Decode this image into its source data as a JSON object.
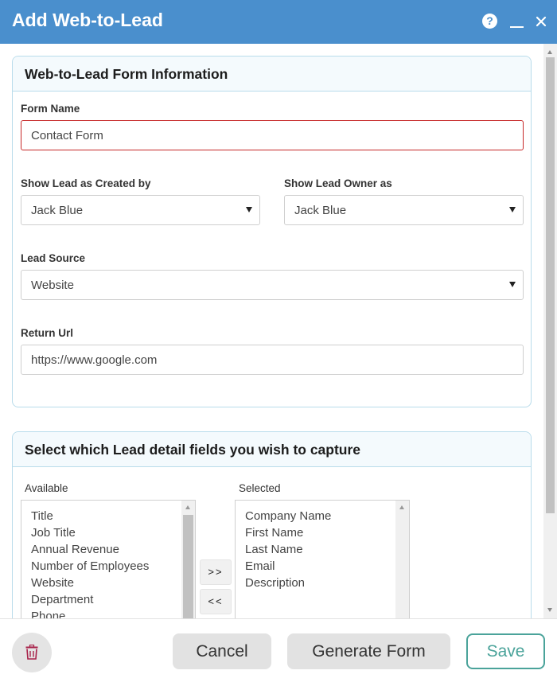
{
  "window": {
    "title": "Add Web-to-Lead"
  },
  "form_info": {
    "heading": "Web-to-Lead Form Information",
    "form_name_label": "Form Name",
    "form_name_value": "Contact Form",
    "created_by_label": "Show Lead as Created by",
    "created_by_value": "Jack Blue",
    "owner_label": "Show Lead Owner as",
    "owner_value": "Jack Blue",
    "source_label": "Lead Source",
    "source_value": "Website",
    "return_url_label": "Return Url",
    "return_url_value": "https://www.google.com"
  },
  "fields": {
    "heading": "Select which Lead detail fields you wish to capture",
    "available_label": "Available",
    "selected_label": "Selected",
    "available": [
      "Title",
      "Job Title",
      "Annual Revenue",
      "Number of Employees",
      "Website",
      "Department",
      "Phone"
    ],
    "selected": [
      "Company Name",
      "First Name",
      "Last Name",
      "Email",
      "Description"
    ],
    "add_label": ">>",
    "remove_label": "<<"
  },
  "footer": {
    "cancel_label": "Cancel",
    "generate_label": "Generate Form",
    "save_label": "Save"
  },
  "colors": {
    "titlebar": "#4a8fcd",
    "save_accent": "#4aa39a",
    "delete_icon": "#a8224a",
    "error_border": "#c62828"
  },
  "icons": {
    "help": "question-circle-icon",
    "minimize": "minimize-icon",
    "close": "close-icon",
    "delete": "trash-icon"
  }
}
